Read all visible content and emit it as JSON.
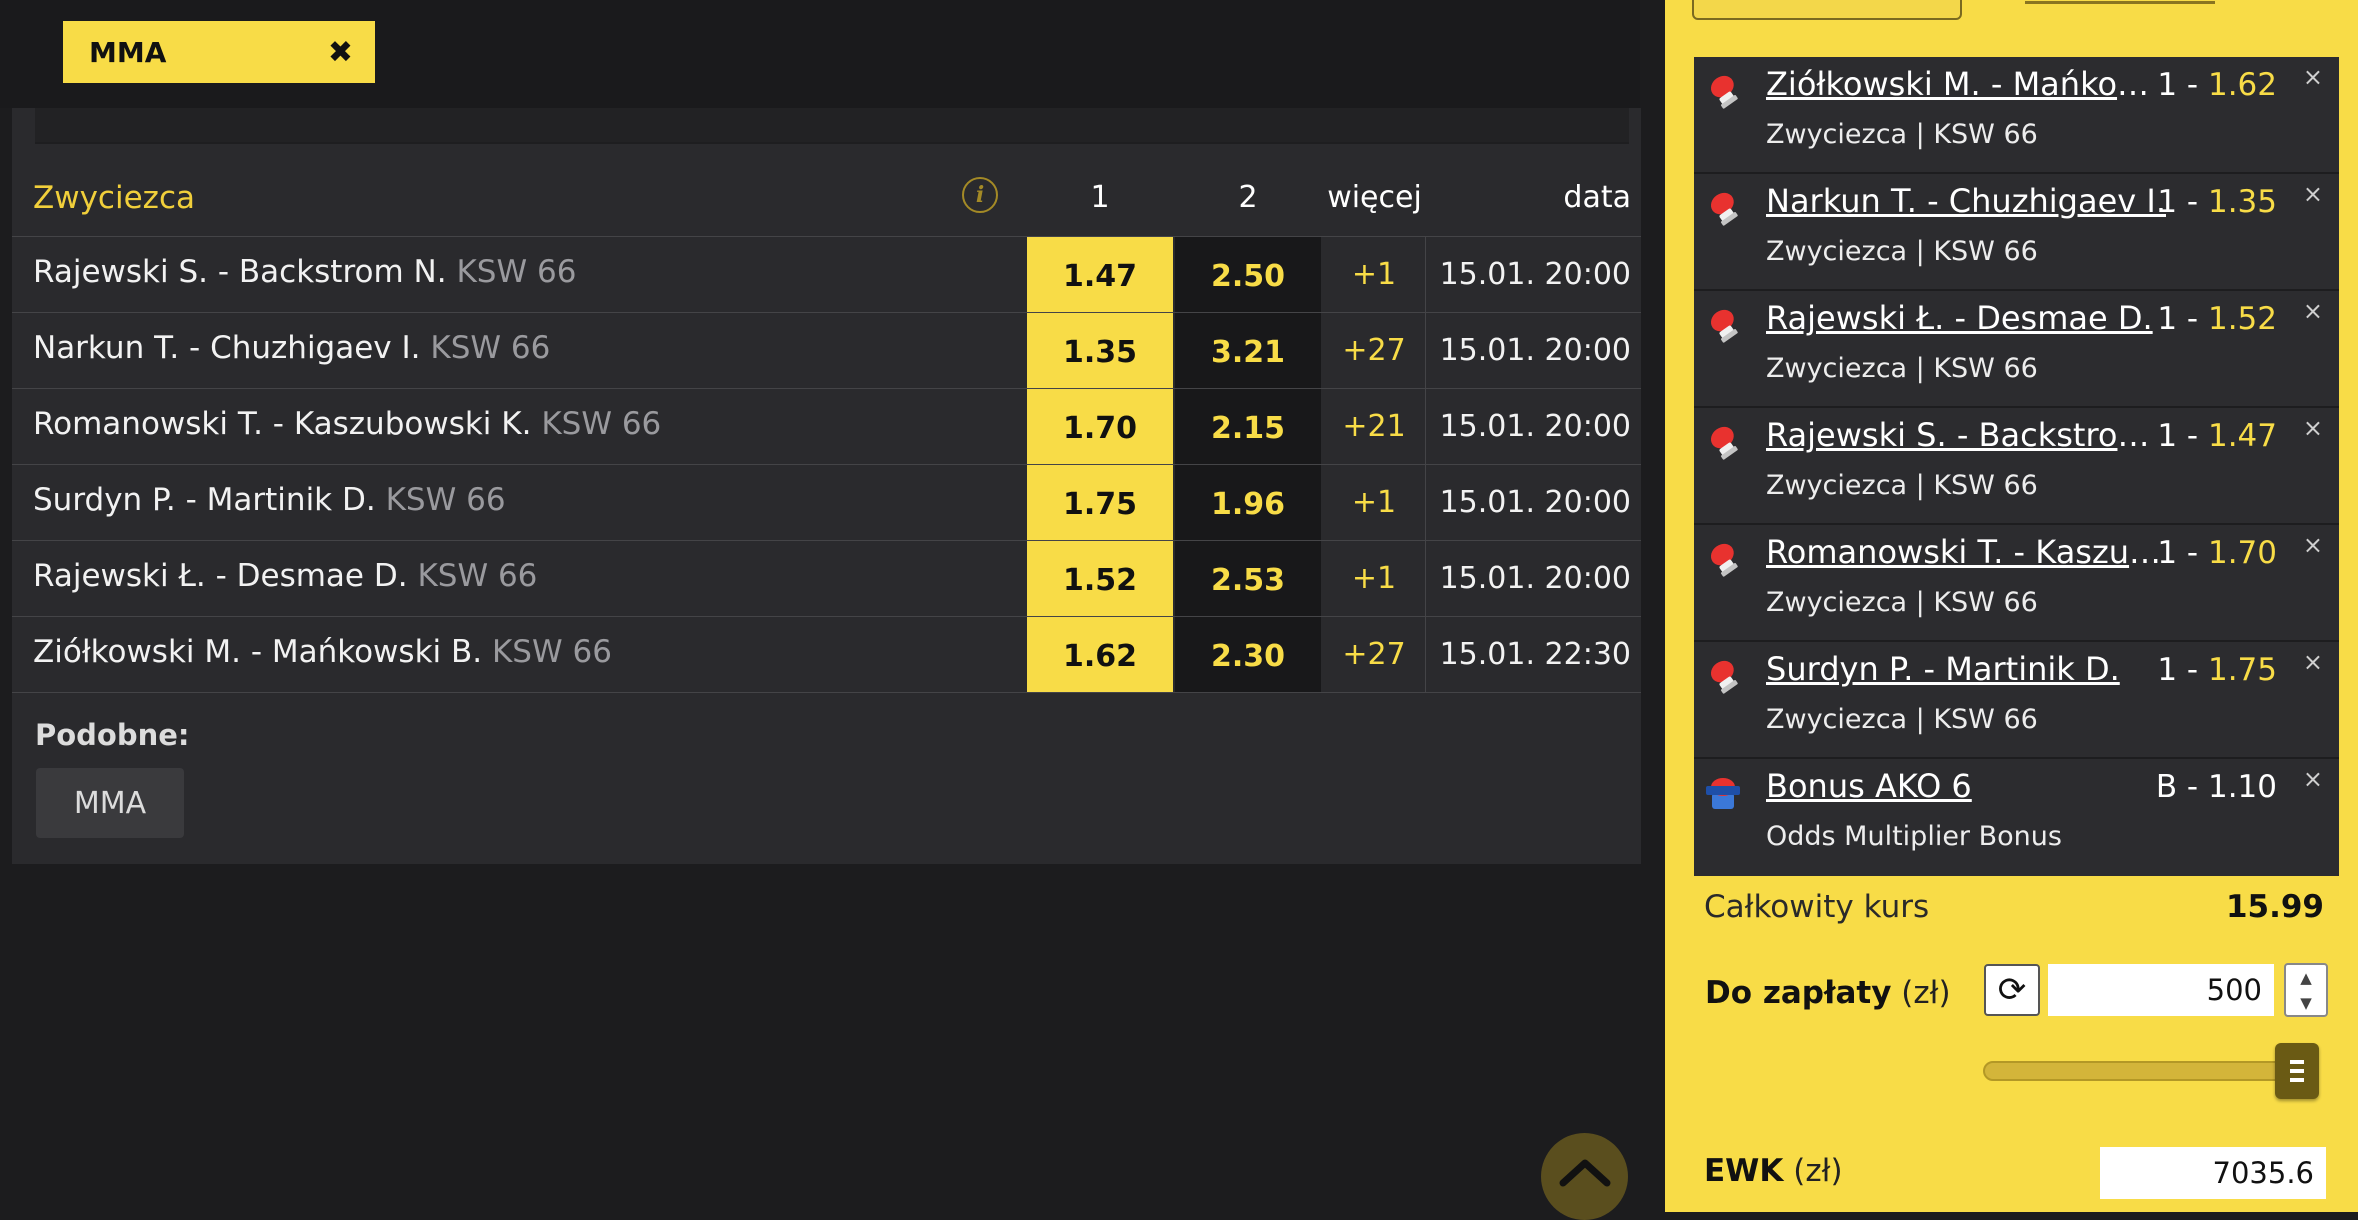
{
  "filter_tab": {
    "label": "MMA",
    "close_icon": "✖"
  },
  "market": {
    "title": "Zwyciezca",
    "info_icon": "i",
    "columns": {
      "one": "1",
      "two": "2",
      "more": "więcej",
      "date": "data"
    },
    "rows": [
      {
        "match": "Rajewski S. - Backstrom N.",
        "league": "KSW 66",
        "odd1": "1.47",
        "odd2": "2.50",
        "more": "+1",
        "date": "15.01. 20:00"
      },
      {
        "match": "Narkun T. - Chuzhigaev I.",
        "league": "KSW 66",
        "odd1": "1.35",
        "odd2": "3.21",
        "more": "+27",
        "date": "15.01. 20:00"
      },
      {
        "match": "Romanowski T. - Kaszubowski K.",
        "league": "KSW 66",
        "odd1": "1.70",
        "odd2": "2.15",
        "more": "+21",
        "date": "15.01. 20:00"
      },
      {
        "match": "Surdyn P. - Martinik D.",
        "league": "KSW 66",
        "odd1": "1.75",
        "odd2": "1.96",
        "more": "+1",
        "date": "15.01. 20:00"
      },
      {
        "match": "Rajewski Ł. - Desmae D.",
        "league": "KSW 66",
        "odd1": "1.52",
        "odd2": "2.53",
        "more": "+1",
        "date": "15.01. 20:00"
      },
      {
        "match": "Ziółkowski M. - Mańkowski B.",
        "league": "KSW 66",
        "odd1": "1.62",
        "odd2": "2.30",
        "more": "+27",
        "date": "15.01. 22:30"
      }
    ]
  },
  "similar": {
    "label": "Podobne:",
    "chip": "MMA"
  },
  "betslip": {
    "bets": [
      {
        "icon": "boxing-glove-icon",
        "title": "Ziółkowski M. - Mańkowski B.",
        "pick_prefix": "1 - ",
        "odd": "1.62",
        "sub": "Zwyciezca | KSW 66",
        "close": "×"
      },
      {
        "icon": "boxing-glove-icon",
        "title": "Narkun T. - Chuzhigaev I.",
        "pick_prefix": "1 - ",
        "odd": "1.35",
        "sub": "Zwyciezca | KSW 66",
        "close": "×"
      },
      {
        "icon": "boxing-glove-icon",
        "title": "Rajewski Ł. - Desmae D.",
        "pick_prefix": "1 - ",
        "odd": "1.52",
        "sub": "Zwyciezca | KSW 66",
        "close": "×"
      },
      {
        "icon": "boxing-glove-icon",
        "title": "Rajewski S. - Backstrom N.",
        "pick_prefix": "1 - ",
        "odd": "1.47",
        "sub": "Zwyciezca | KSW 66",
        "close": "×"
      },
      {
        "icon": "boxing-glove-icon",
        "title": "Romanowski T. - Kaszubowski K.",
        "pick_prefix": "1 - ",
        "odd": "1.70",
        "sub": "Zwyciezca | KSW 66",
        "close": "×"
      },
      {
        "icon": "boxing-glove-icon",
        "title": "Surdyn P. - Martinik D.",
        "pick_prefix": "1 - ",
        "odd": "1.75",
        "sub": "Zwyciezca | KSW 66",
        "close": "×"
      },
      {
        "icon": "bonus-icon",
        "title": "Bonus AKO 6",
        "pick_prefix": "B - 1.10",
        "odd": "",
        "sub": "Odds Multiplier Bonus",
        "close": "×"
      }
    ],
    "total_label": "Całkowity kurs",
    "total_value": "15.99",
    "pay_label": "Do zapłaty",
    "pay_unit": "(zł)",
    "stake_value": "500",
    "stepper_up": "▲",
    "stepper_down": "▼",
    "refresh_icon": "⟳",
    "slider_level": 1.0,
    "ewk_label": "EWK",
    "ewk_unit": "(zł)",
    "ewk_value": "7035.6"
  },
  "colors": {
    "accent": "#f8dc47",
    "background": "#1c1c1e",
    "panel": "#2a2a2d",
    "muted": "#9a9a9e"
  }
}
